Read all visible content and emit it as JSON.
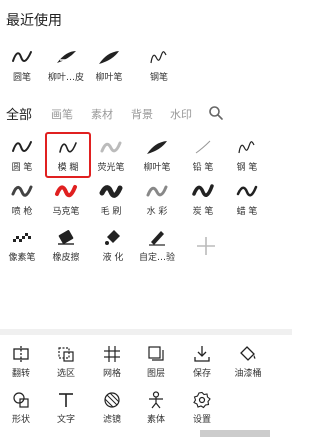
{
  "recent": {
    "title": "最近使用",
    "items": [
      {
        "label": "圆笔",
        "icon": "round-pen-icon"
      },
      {
        "label": "柳叶…皮",
        "icon": "willow-eraser-icon"
      },
      {
        "label": "柳叶笔",
        "icon": "willow-pen-icon"
      },
      {
        "label": "钢笔",
        "icon": "fountain-pen-icon"
      }
    ]
  },
  "tabs": [
    {
      "label": "全部",
      "active": true
    },
    {
      "label": "画笔",
      "active": false
    },
    {
      "label": "素材",
      "active": false
    },
    {
      "label": "背景",
      "active": false
    },
    {
      "label": "水印",
      "active": false
    }
  ],
  "brushes": [
    {
      "label": "圆 笔",
      "icon": "round-pen-icon"
    },
    {
      "label": "模 糊",
      "icon": "blur-icon",
      "selected": true
    },
    {
      "label": "荧光笔",
      "icon": "highlighter-icon"
    },
    {
      "label": "柳叶笔",
      "icon": "willow-pen-icon"
    },
    {
      "label": "铅 笔",
      "icon": "pencil-icon"
    },
    {
      "label": "钢 笔",
      "icon": "fountain-pen-icon"
    },
    {
      "label": "喷 枪",
      "icon": "airbrush-icon"
    },
    {
      "label": "马克笔",
      "icon": "marker-icon"
    },
    {
      "label": "毛 刷",
      "icon": "bristle-brush-icon"
    },
    {
      "label": "水 彩",
      "icon": "watercolor-icon"
    },
    {
      "label": "炭 笔",
      "icon": "charcoal-icon"
    },
    {
      "label": "蜡 笔",
      "icon": "crayon-icon"
    },
    {
      "label": "像素笔",
      "icon": "pixel-pen-icon"
    },
    {
      "label": "橡皮擦",
      "icon": "eraser-icon"
    },
    {
      "label": "液 化",
      "icon": "liquify-icon"
    },
    {
      "label": "自定…验",
      "icon": "custom-brush-icon"
    }
  ],
  "tools": [
    {
      "label": "翻转",
      "icon": "flip-icon"
    },
    {
      "label": "选区",
      "icon": "selection-icon"
    },
    {
      "label": "网格",
      "icon": "grid-icon"
    },
    {
      "label": "图层",
      "icon": "layers-icon"
    },
    {
      "label": "保存",
      "icon": "save-icon"
    },
    {
      "label": "油漆桶",
      "icon": "paint-bucket-icon"
    },
    {
      "label": "形状",
      "icon": "shape-icon"
    },
    {
      "label": "文字",
      "icon": "text-icon"
    },
    {
      "label": "滤镜",
      "icon": "filter-icon"
    },
    {
      "label": "素体",
      "icon": "body-model-icon"
    },
    {
      "label": "设置",
      "icon": "settings-icon"
    }
  ],
  "colors": {
    "selected_border": "#e02020",
    "icon": "#222222",
    "tab_inactive": "#999999"
  }
}
